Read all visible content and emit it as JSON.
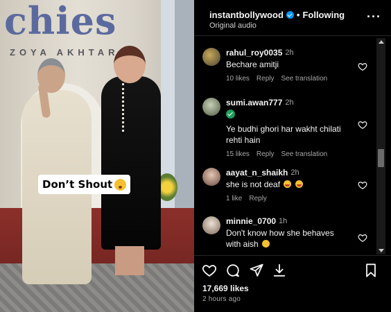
{
  "media": {
    "backdrop_title": "chies",
    "backdrop_subtitle": "ZOYA AKHTAR",
    "sticker_text": "Don’t Shout",
    "sticker_emoji": "shushing-face-emoji"
  },
  "header": {
    "username": "instantbollywood",
    "separator": "•",
    "follow_status": "Following",
    "audio": "Original audio",
    "more_icon": "ellipsis-icon"
  },
  "comments": [
    {
      "username": "rahul_roy0035",
      "time": "2h",
      "text": "Bechare amitji",
      "likes": "10 likes",
      "reply": "Reply",
      "translation": "See translation",
      "avatar_color": "#6a6242"
    },
    {
      "username": "sumi.awan777",
      "time": "2h",
      "text": "Ye budhi ghori har wakht chilati rehti hain",
      "likes": "15 likes",
      "reply": "Reply",
      "translation": "See translation",
      "avatar_color": "#8a9a7b"
    },
    {
      "username": "aayat_n_shaikh",
      "time": "2h",
      "text": "she is not deaf",
      "likes": "1 like",
      "reply": "Reply",
      "avatar_color": "#a2766a"
    },
    {
      "username": "minnie_0700",
      "time": "1h",
      "text": "Don't know how she behaves with aish",
      "avatar_color": "#b9a394"
    }
  ],
  "footer": {
    "likes": "17,669 likes",
    "time_ago": "2 hours ago"
  },
  "colors": {
    "background": "#000000",
    "text": "#f5f5f5",
    "muted": "#a8a8a8",
    "verified": "#0095f6"
  }
}
